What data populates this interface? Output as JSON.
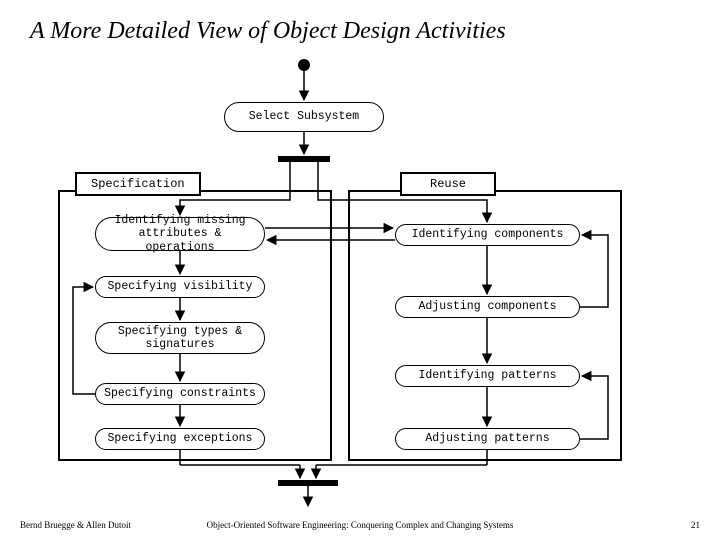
{
  "title": "A More Detailed View of Object Design Activities",
  "start_node": "Select Subsystem",
  "frames": {
    "left_label": "Specification",
    "right_label": "Reuse"
  },
  "left_activities": [
    "Identifying missing attributes & operations",
    "Specifying visibility",
    "Specifying types & signatures",
    "Specifying constraints",
    "Specifying exceptions"
  ],
  "right_activities": [
    "Identifying components",
    "Adjusting components",
    "Identifying patterns",
    "Adjusting patterns"
  ],
  "footer": {
    "left": "Bernd Bruegge & Allen Dutoit",
    "center": "Object-Oriented Software Engineering: Conquering Complex and Changing Systems",
    "right": "21"
  }
}
